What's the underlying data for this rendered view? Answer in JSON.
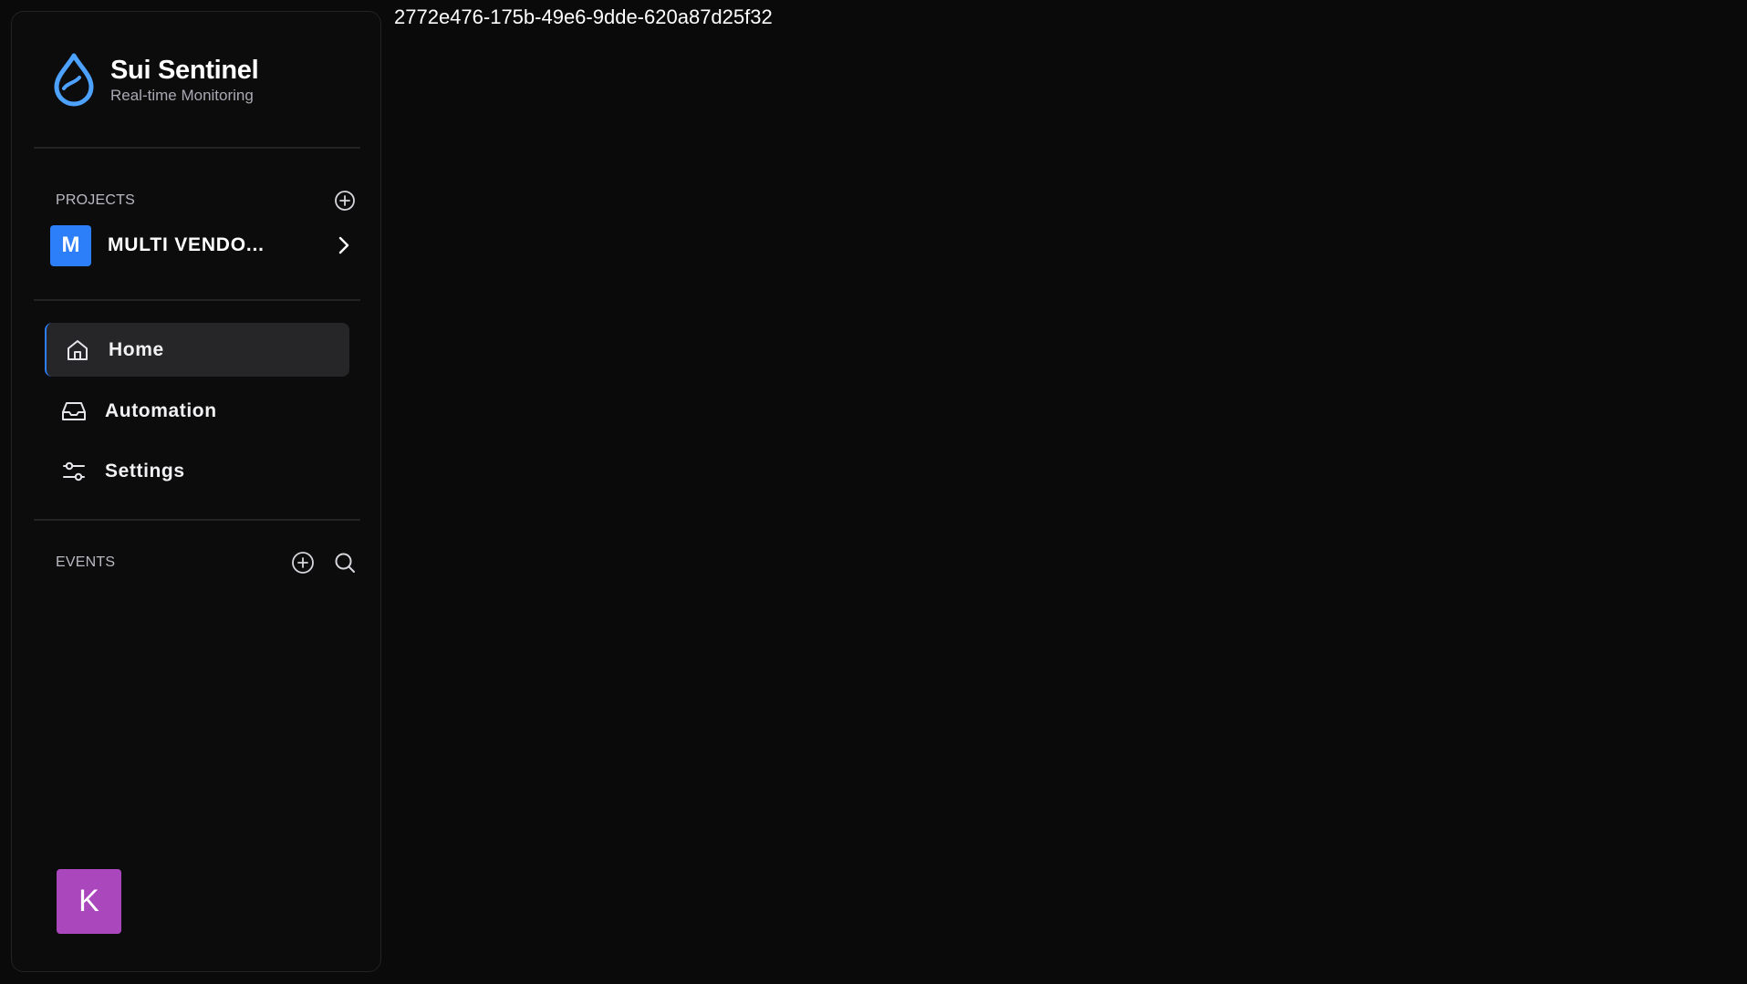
{
  "brand": {
    "title": "Sui Sentinel",
    "subtitle": "Real-time Monitoring",
    "logo_icon": "water-drop-icon",
    "accent_color": "#4da2ff"
  },
  "projects": {
    "label": "PROJECTS",
    "add_icon": "plus-circle-icon",
    "items": [
      {
        "initial": "M",
        "name": "MULTI VENDO...",
        "color": "#2d7ff9",
        "chevron_icon": "chevron-right-icon"
      }
    ]
  },
  "nav": {
    "items": [
      {
        "label": "Home",
        "icon": "home-icon",
        "active": true
      },
      {
        "label": "Automation",
        "icon": "inbox-icon",
        "active": false
      },
      {
        "label": "Settings",
        "icon": "sliders-icon",
        "active": false
      }
    ]
  },
  "events": {
    "label": "EVENTS",
    "add_icon": "plus-circle-icon",
    "search_icon": "search-icon"
  },
  "user": {
    "initial": "K",
    "color": "#ab47bc"
  },
  "main": {
    "id_text": "2772e476-175b-49e6-9dde-620a87d25f32"
  }
}
